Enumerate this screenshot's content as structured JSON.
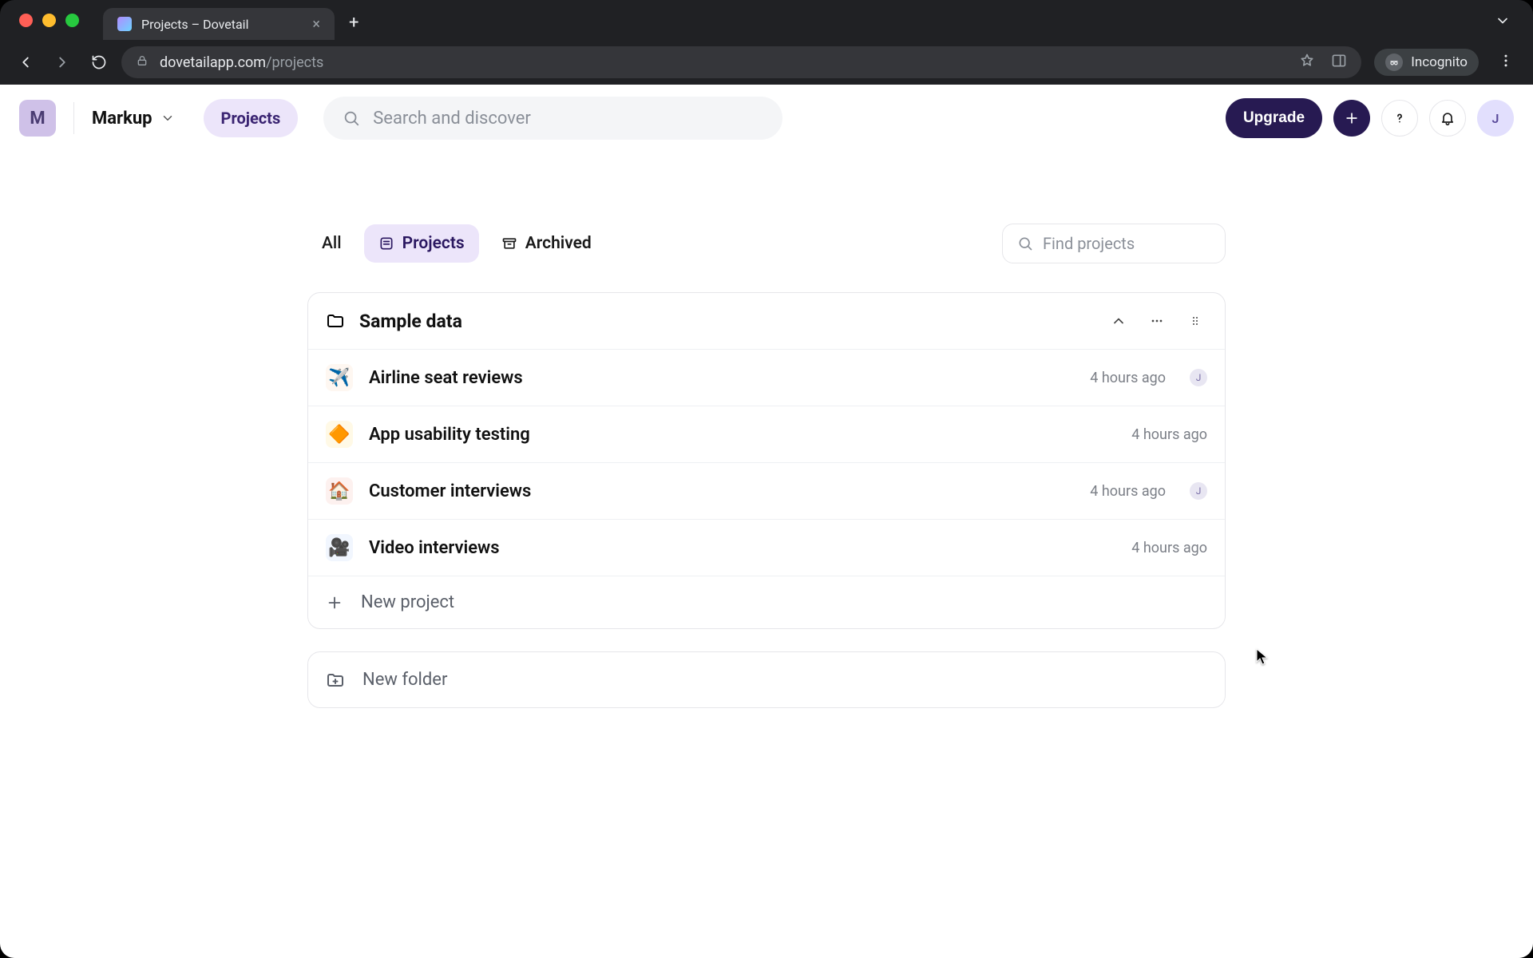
{
  "browser": {
    "tab_title": "Projects – Dovetail",
    "url_host": "dovetailapp.com",
    "url_path": "/projects",
    "incognito_label": "Incognito"
  },
  "header": {
    "workspace_initial": "M",
    "workspace_name": "Markup",
    "nav_projects": "Projects",
    "search_placeholder": "Search and discover",
    "upgrade_label": "Upgrade",
    "user_initial": "J"
  },
  "toolbar": {
    "tab_all": "All",
    "tab_projects": "Projects",
    "tab_archived": "Archived",
    "find_placeholder": "Find projects"
  },
  "folder": {
    "name": "Sample data",
    "new_project_label": "New project",
    "projects": [
      {
        "emoji": "✈️",
        "name": "Airline seat reviews",
        "time": "4 hours ago",
        "has_avatar": true,
        "avatar": "J"
      },
      {
        "emoji": "🔶",
        "name": "App usability testing",
        "time": "4 hours ago",
        "has_avatar": false,
        "avatar": ""
      },
      {
        "emoji": "🏠",
        "name": "Customer interviews",
        "time": "4 hours ago",
        "has_avatar": true,
        "avatar": "J"
      },
      {
        "emoji": "🎥",
        "name": "Video interviews",
        "time": "4 hours ago",
        "has_avatar": false,
        "avatar": ""
      }
    ]
  },
  "new_folder_label": "New folder",
  "colors": {
    "accent": "#271a52",
    "pill_bg": "#ece5fa"
  }
}
